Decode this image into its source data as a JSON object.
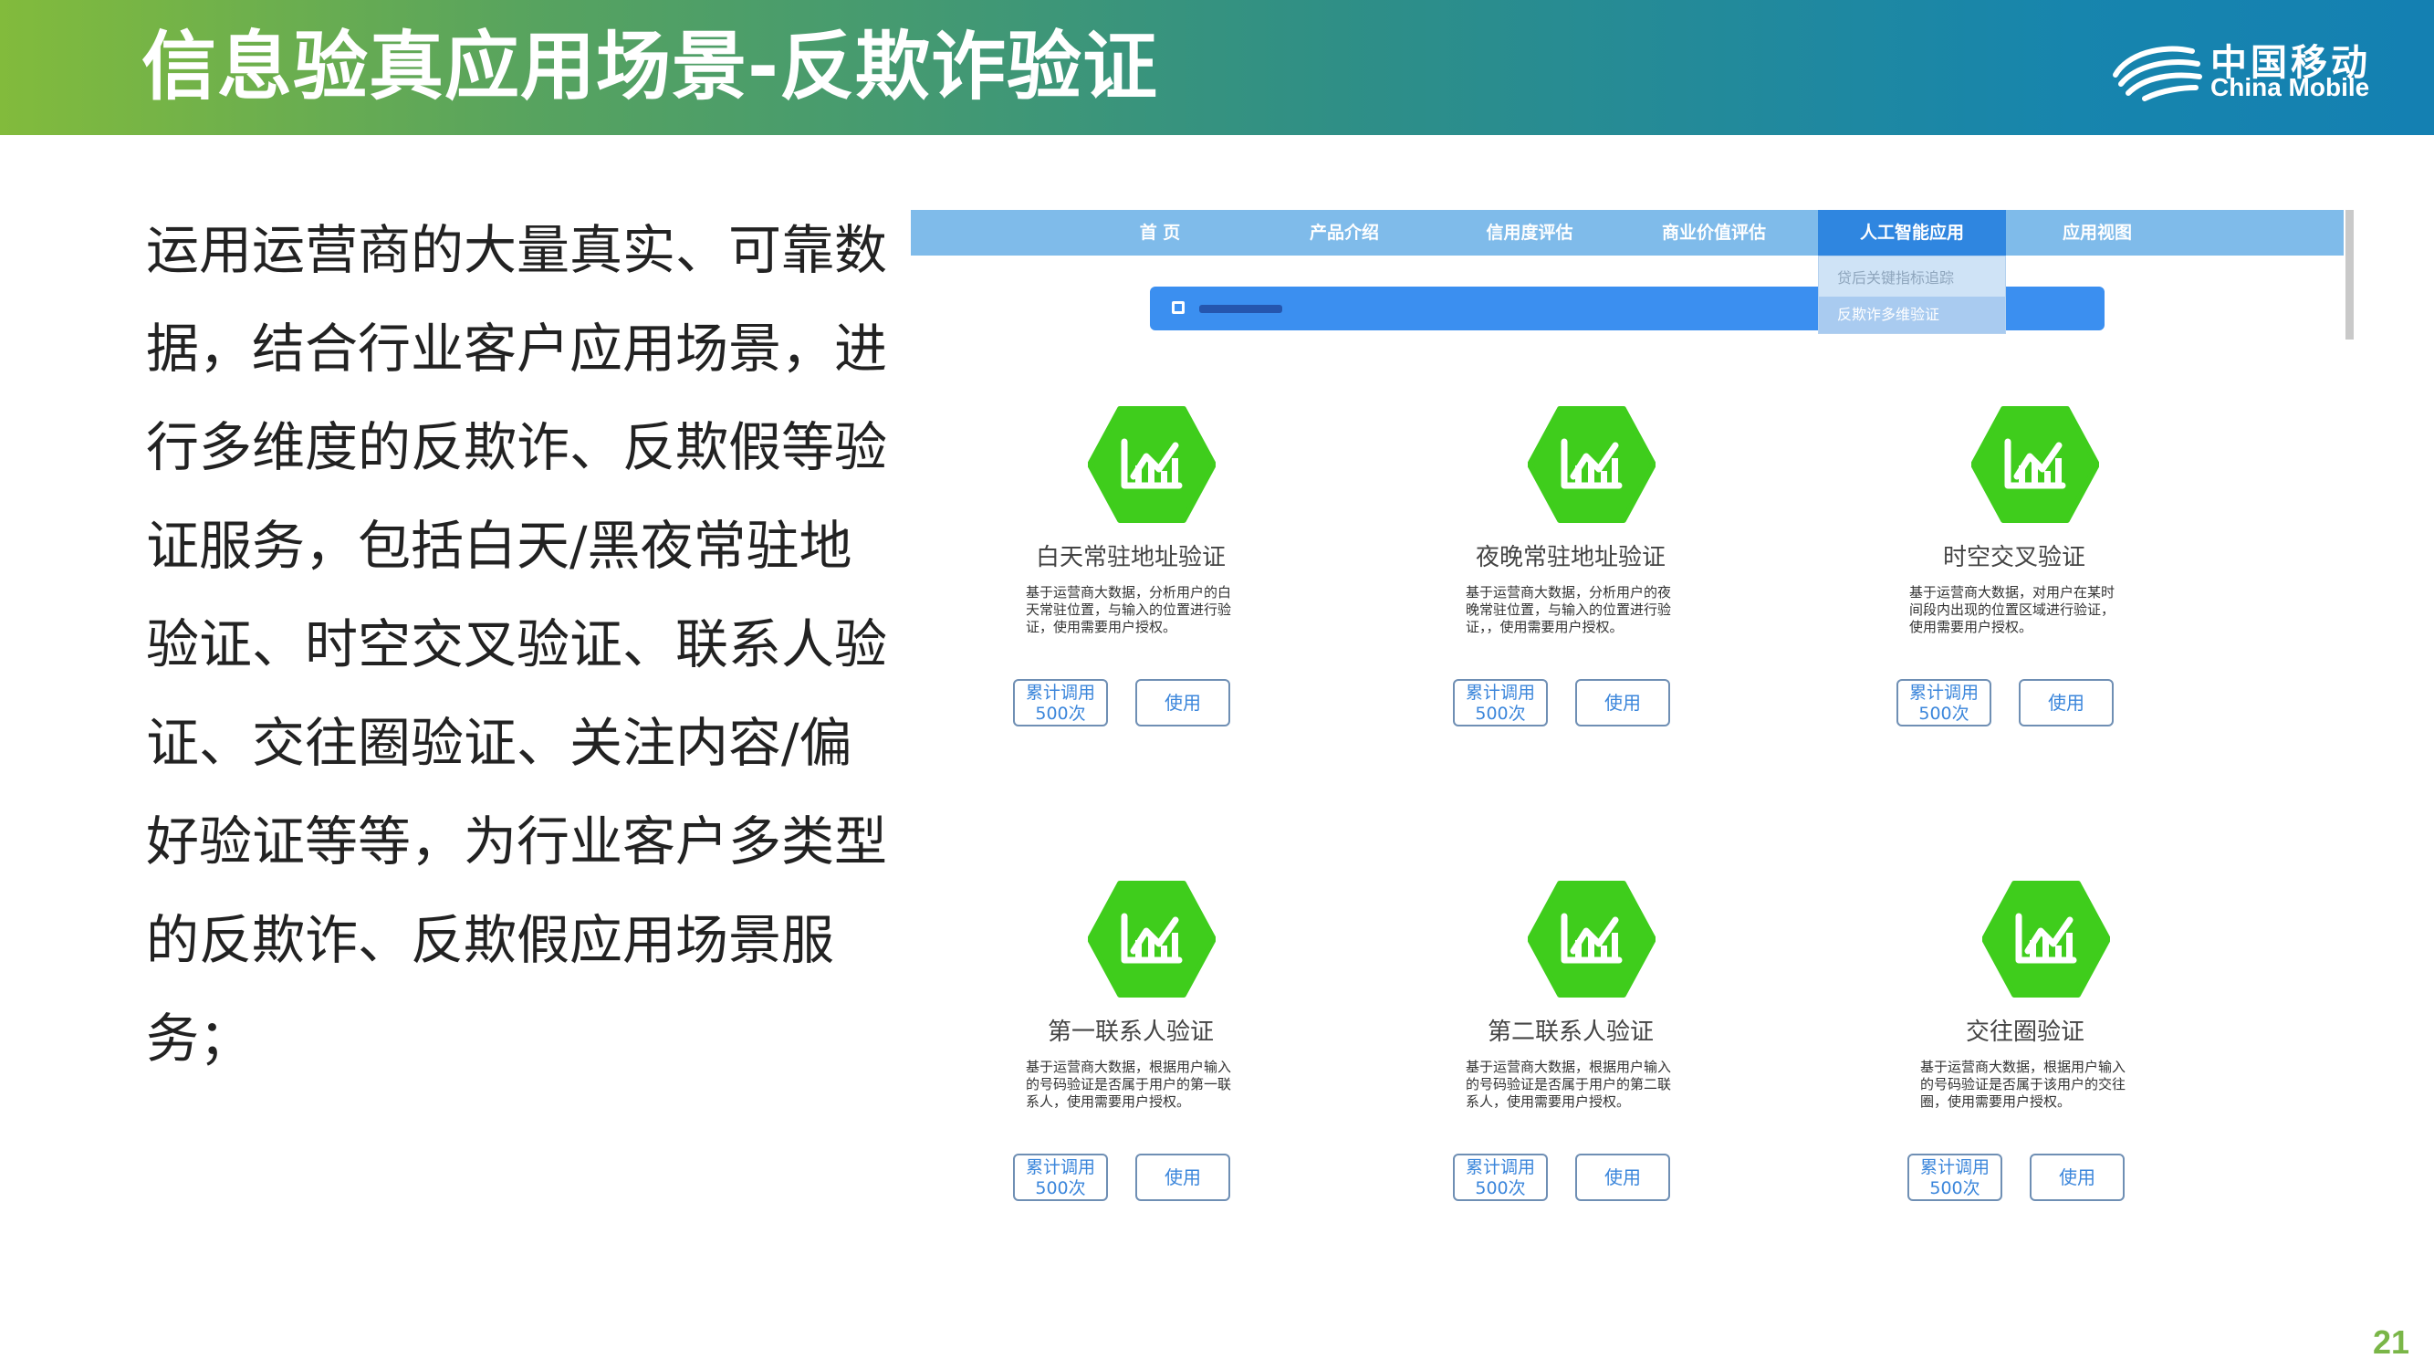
{
  "slide": {
    "title": "信息验真应用场景-反欺诈验证",
    "page_number": "21",
    "logo": {
      "cn": "中国移动",
      "en": "China Mobile"
    },
    "paragraph": "运用运营商的大量真实、可靠数据，结合行业客户应用场景，进行多维度的反欺诈、反欺假等验证服务，包括白天/黑夜常驻地验证、时空交叉验证、联系人验证、交往圈验证、关注内容/偏好验证等等，为行业客户多类型的反欺诈、反欺假应用场景服务；"
  },
  "screenshot": {
    "nav": [
      "首 页",
      "产品介绍",
      "信用度评估",
      "商业价值评估",
      "人工智能应用",
      "应用视图"
    ],
    "active_nav": "人工智能应用",
    "dropdown": [
      "贷后关键指标追踪",
      "反欺诈多维验证"
    ],
    "search_text": "■■■■■■",
    "cards": [
      {
        "title": "白天常驻地址验证",
        "desc": "基于运营商大数据，分析用户的白天常驻位置，与输入的位置进行验证，使用需要用户授权。",
        "count_label": "累计调用",
        "count_value": "500次",
        "use_label": "使用"
      },
      {
        "title": "夜晚常驻地址验证",
        "desc": "基于运营商大数据，分析用户的夜晚常驻位置，与输入的位置进行验证，，使用需要用户授权。",
        "count_label": "累计调用",
        "count_value": "500次",
        "use_label": "使用"
      },
      {
        "title": "时空交叉验证",
        "desc": "基于运营商大数据，对用户在某时间段内出现的位置区域进行验证，使用需要用户授权。",
        "count_label": "累计调用",
        "count_value": "500次",
        "use_label": "使用"
      },
      {
        "title": "第一联系人验证",
        "desc": "基于运营商大数据，根据用户输入的号码验证是否属于用户的第一联系人，使用需要用户授权。",
        "count_label": "累计调用",
        "count_value": "500次",
        "use_label": "使用"
      },
      {
        "title": "第二联系人验证",
        "desc": "基于运营商大数据，根据用户输入的号码验证是否属于用户的第二联系人，使用需要用户授权。",
        "count_label": "累计调用",
        "count_value": "500次",
        "use_label": "使用"
      },
      {
        "title": "交往圈验证",
        "desc": "基于运营商大数据，根据用户输入的号码验证是否属于该用户的交往圈，使用需要用户授权。",
        "count_label": "累计调用",
        "count_value": "500次",
        "use_label": "使用"
      }
    ],
    "colors": {
      "nav_bg": "#7fbbea",
      "nav_active": "#2f86e0",
      "icon_green": "#3fcd1c",
      "button_text": "#3b86db"
    }
  }
}
